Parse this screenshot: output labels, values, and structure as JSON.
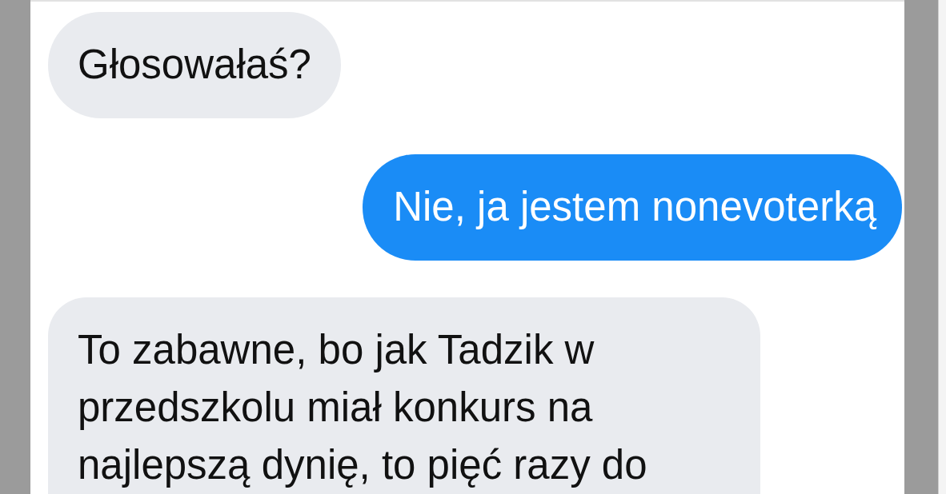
{
  "messages": [
    {
      "kind": "received",
      "text": "Głosowałaś?"
    },
    {
      "kind": "sent",
      "text": "Nie, ja jestem nonevoterką"
    },
    {
      "kind": "received",
      "text": "To zabawne, bo jak Tadzik w przedszkolu miał konkurs na najlepszą dynię, to pięć razy do"
    }
  ]
}
